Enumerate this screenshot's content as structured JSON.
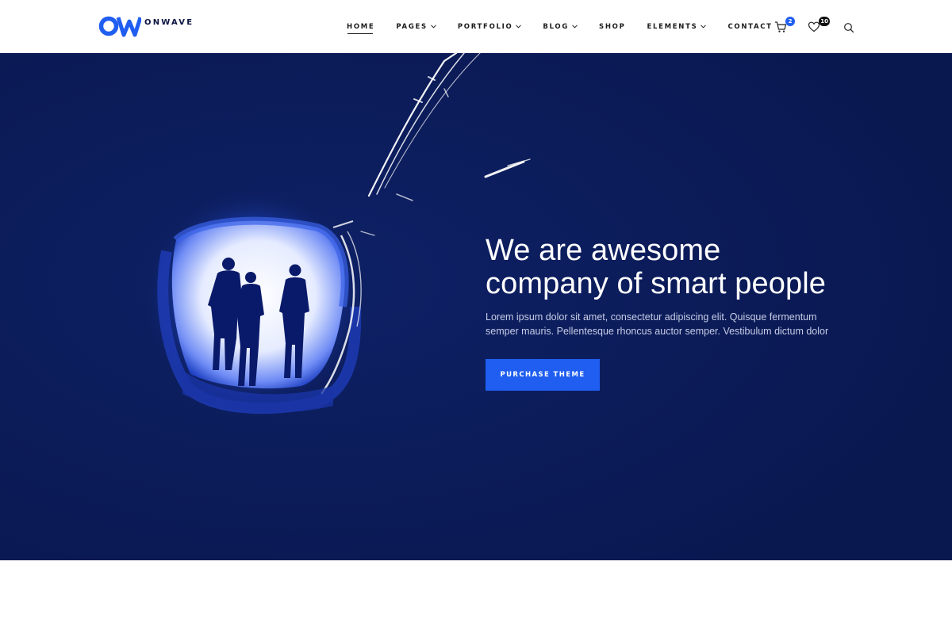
{
  "brand": {
    "name": "ONWAVE",
    "logo_icon": "ow-monogram-logo",
    "accent_color": "#1f5ef0",
    "dark_color": "#0b1a52"
  },
  "nav": {
    "items": [
      {
        "label": "HOME",
        "active": true,
        "has_dropdown": false
      },
      {
        "label": "PAGES",
        "active": false,
        "has_dropdown": true
      },
      {
        "label": "PORTFOLIO",
        "active": false,
        "has_dropdown": true
      },
      {
        "label": "BLOG",
        "active": false,
        "has_dropdown": true
      },
      {
        "label": "SHOP",
        "active": false,
        "has_dropdown": false
      },
      {
        "label": "ELEMENTS",
        "active": false,
        "has_dropdown": true
      },
      {
        "label": "CONTACT",
        "active": false,
        "has_dropdown": false
      }
    ]
  },
  "header_icons": {
    "cart": {
      "icon": "cart-icon",
      "count": "2",
      "badge_color": "#1f5ef0"
    },
    "wishlist": {
      "icon": "heart-icon",
      "count": "10",
      "badge_color": "#111111"
    },
    "search": {
      "icon": "search-icon"
    }
  },
  "hero": {
    "title_line1": "We are awesome",
    "title_line2": "company of smart people",
    "text": "Lorem ipsum dolor sit amet, consectetur adipiscing elit. Quisque fermentum semper mauris. Pellentesque rhoncus auctor semper. Vestibulum dictum dolor",
    "cta_label": "PURCHASE THEME"
  }
}
